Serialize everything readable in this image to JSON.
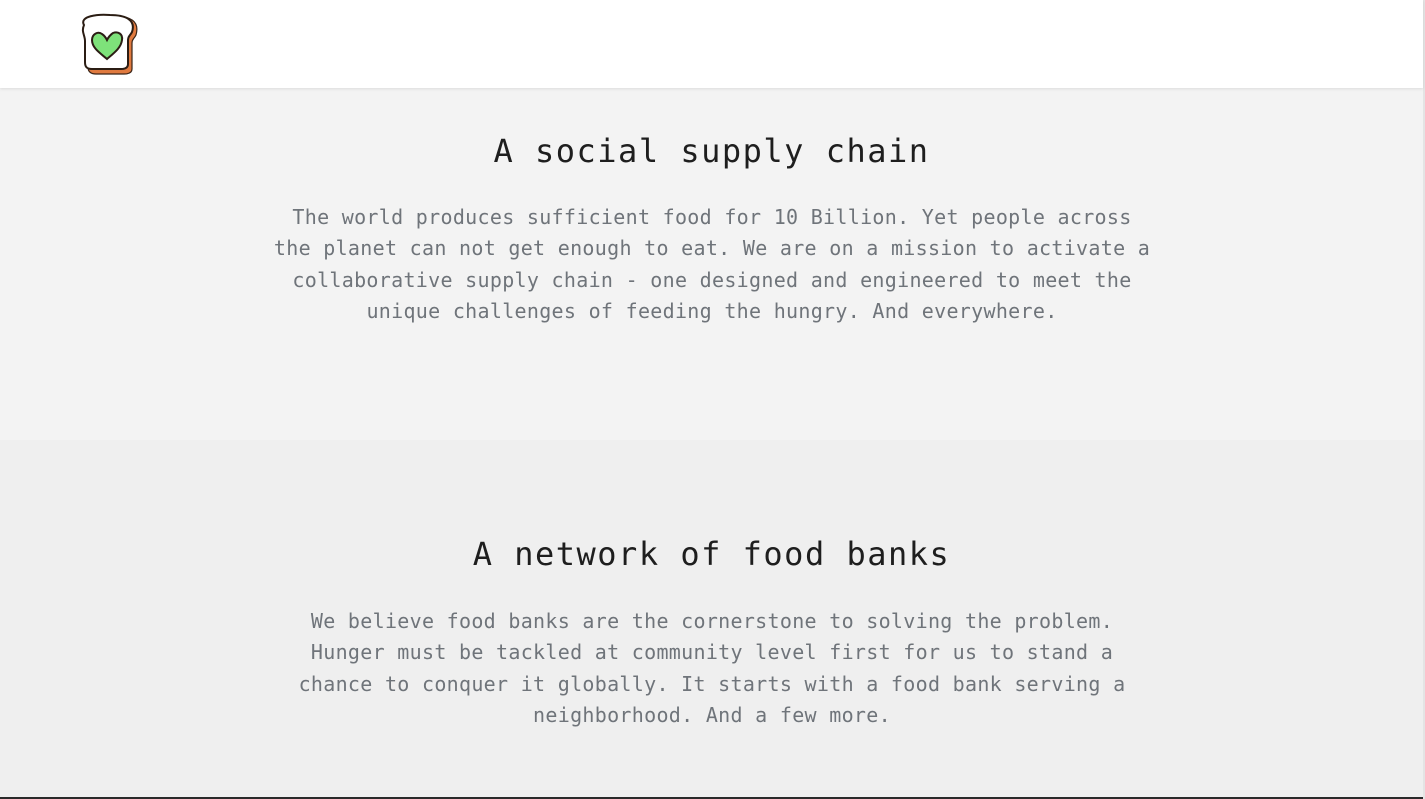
{
  "header": {
    "logo_icon": "toast-heart-logo-icon",
    "colors": {
      "crust": "#e07a3f",
      "bread": "#ffffff",
      "heart": "#7ee27a",
      "outline": "#2b1d14"
    }
  },
  "sections": [
    {
      "title": "A social supply chain",
      "body": "The world produces sufficient food for 10 Billion. Yet people across the planet can not get enough to eat. We are on a mission to activate a collaborative supply chain - one designed and engineered to meet the unique challenges of feeding the hungry. And everywhere."
    },
    {
      "title": "A network of food banks",
      "body": "We believe food banks are the cornerstone to solving the problem. Hunger must be tackled at community level first for us to stand a chance to conquer it globally. It starts with a food bank serving a neighborhood. And a few more."
    }
  ]
}
